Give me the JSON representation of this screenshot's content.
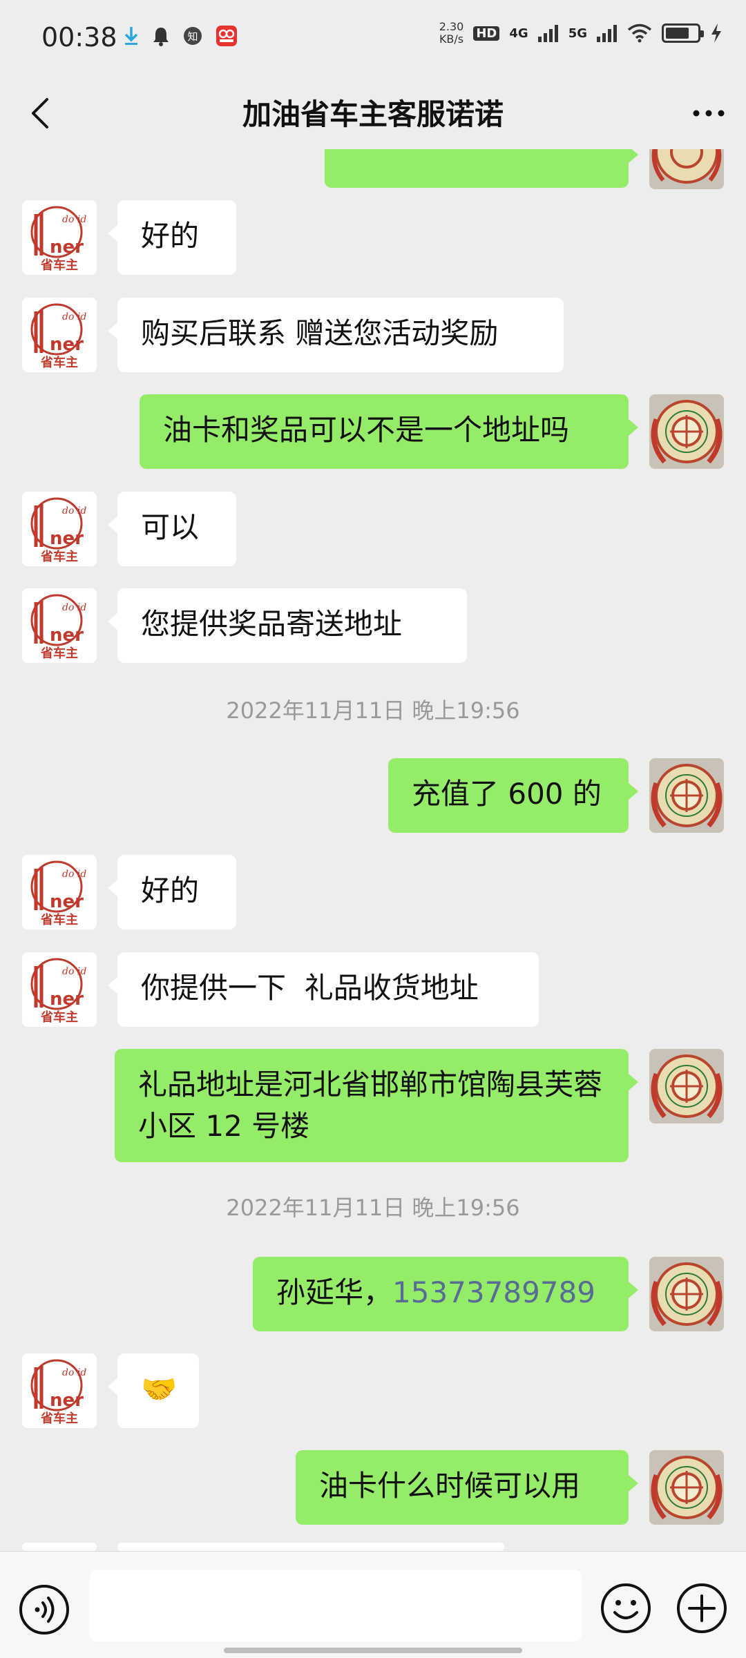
{
  "status_bar": {
    "time": "00:38",
    "net_speed_value": "2.30",
    "net_speed_unit": "KB/s",
    "hd_label": "HD",
    "sim1_label": "4G",
    "sim2_label": "5G",
    "battery_level": 0.75
  },
  "header": {
    "title": "加油省车主客服诺诺"
  },
  "messages": [
    {
      "side": "left",
      "text": "好的"
    },
    {
      "side": "left",
      "text": "购买后联系 赠送您活动奖励"
    },
    {
      "side": "right",
      "text": "油卡和奖品可以不是一个地址吗"
    },
    {
      "side": "left",
      "text": "可以"
    },
    {
      "side": "left",
      "text": "您提供奖品寄送地址"
    },
    {
      "timestamp": "2022年11月11日 晚上19:56"
    },
    {
      "side": "right",
      "text": "充值了 600 的"
    },
    {
      "side": "left",
      "text": "好的"
    },
    {
      "side": "left",
      "text": "你提供一下  礼品收货地址"
    },
    {
      "side": "right",
      "text": "礼品地址是河北省邯郸市馆陶县芙蓉小区 12 号楼"
    },
    {
      "timestamp": "2022年11月11日 晚上19:56"
    },
    {
      "side": "right",
      "text": "孙延华，",
      "phone": "15373789789"
    },
    {
      "side": "left",
      "text": "🤝"
    },
    {
      "side": "right",
      "text": "油卡什么时候可以用"
    }
  ],
  "avatars": {
    "agent_logo_text": "省车主",
    "agent_logo_brand": "ner"
  },
  "input_bar": {
    "placeholder": ""
  },
  "colors": {
    "background": "#ededed",
    "self_bubble": "#95ec69",
    "other_bubble": "#ffffff",
    "link": "#576b95"
  }
}
